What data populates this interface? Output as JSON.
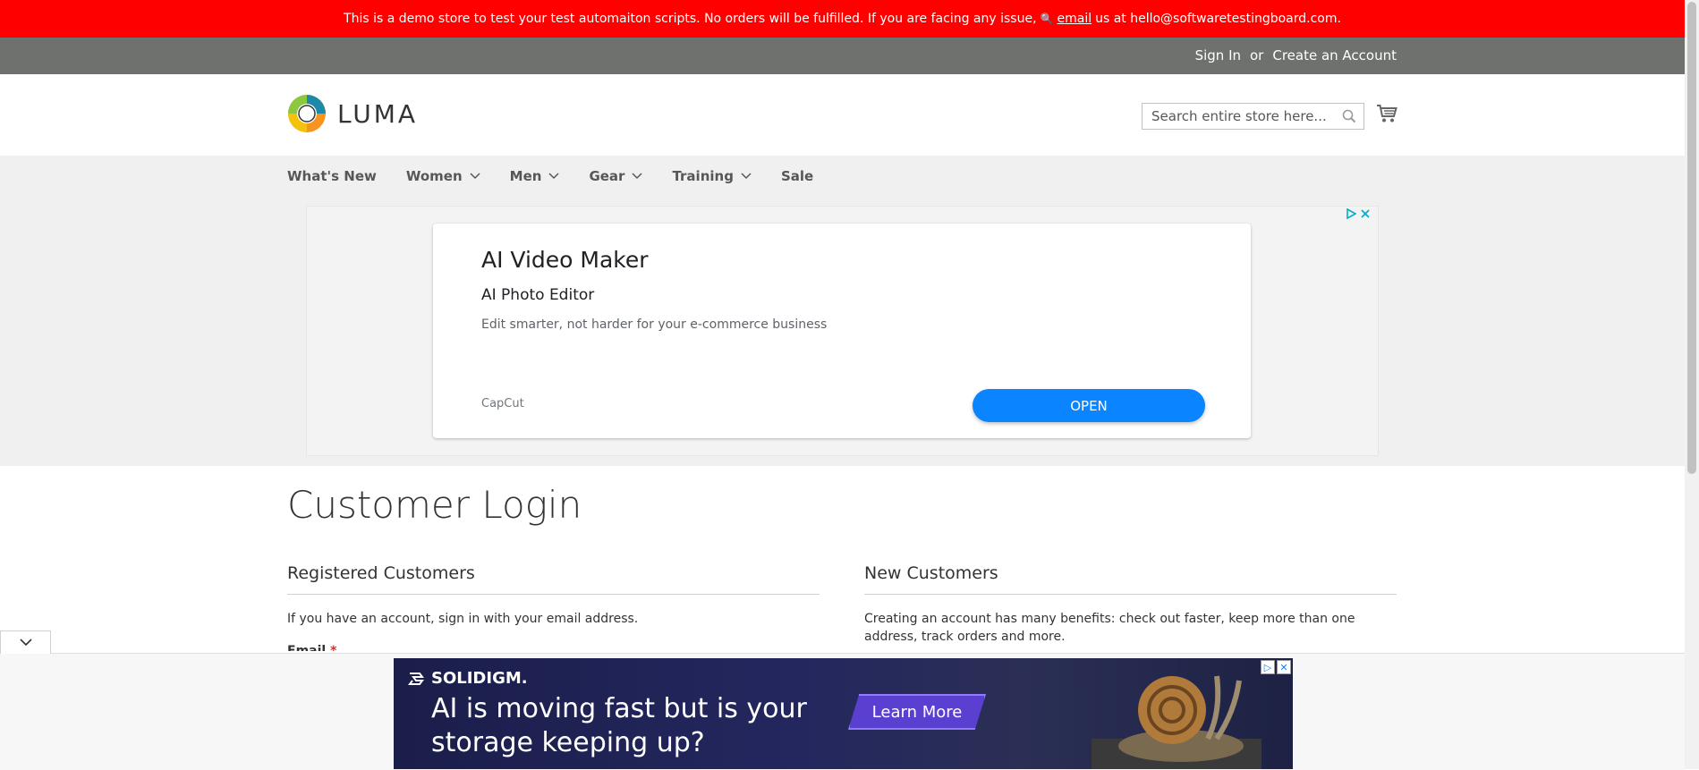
{
  "demo_notice": {
    "text_before": "This is a demo store to test your test automaiton scripts. No orders will be fulfilled. If you are facing any issue,",
    "link_text": "email",
    "text_after": "us at hello@softwaretestingboard.com."
  },
  "account_bar": {
    "sign_in": "Sign In",
    "or": "or",
    "create_account": "Create an Account"
  },
  "header": {
    "logo_text": "LUMA",
    "search": {
      "placeholder": "Search entire store here..."
    }
  },
  "nav": {
    "items": [
      {
        "label": "What's New",
        "has_menu": false
      },
      {
        "label": "Women",
        "has_menu": true
      },
      {
        "label": "Men",
        "has_menu": true
      },
      {
        "label": "Gear",
        "has_menu": true
      },
      {
        "label": "Training",
        "has_menu": true
      },
      {
        "label": "Sale",
        "has_menu": false
      }
    ]
  },
  "ad": {
    "title": "AI Video Maker",
    "subtitle": "AI Photo Editor",
    "description": "Edit smarter, not harder for your e-commerce business",
    "brand": "CapCut",
    "button": "OPEN",
    "accent_color": "#0a84ff"
  },
  "page": {
    "title": "Customer Login",
    "registered": {
      "title": "Registered Customers",
      "text": "If you have an account, sign in with your email address.",
      "email_label": "Email",
      "required_mark": "*"
    },
    "new_customers": {
      "title": "New Customers",
      "text": "Creating an account has many benefits: check out faster, keep more than one address, track orders and more."
    }
  },
  "bottom_ad": {
    "brand": "SOLIDIGM.",
    "headline": "AI is moving fast but is your storage keeping up?",
    "button": "Learn More"
  },
  "colors": {
    "demo_bar": "#ff0000",
    "account_bar": "#6e716e",
    "nav_bg": "#f0f0f0"
  }
}
